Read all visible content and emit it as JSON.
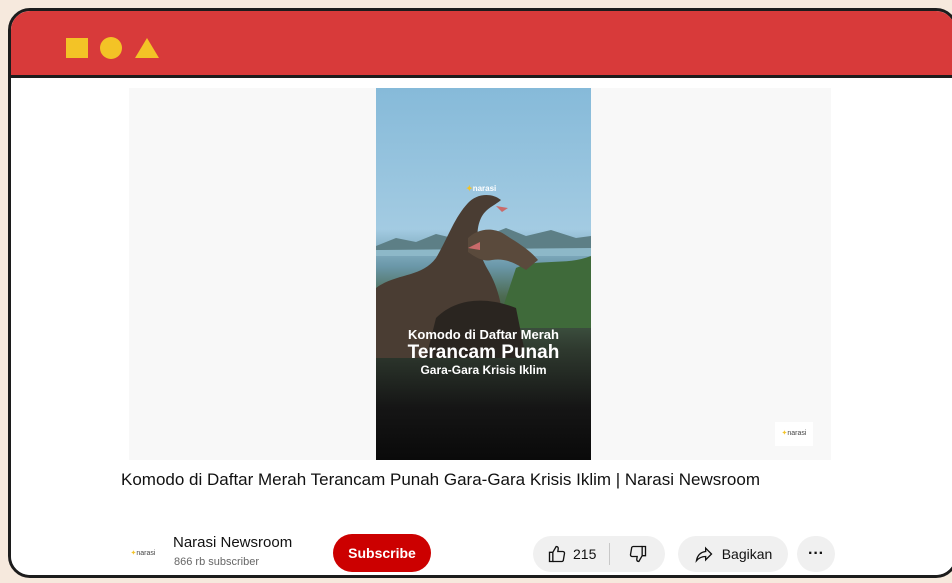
{
  "window": {
    "controls": [
      "square-icon",
      "circle-icon",
      "triangle-icon"
    ],
    "accent_color": "#d83a3a",
    "control_color": "#f3c326"
  },
  "video": {
    "overlay_line1": "Komodo di Daftar Merah",
    "overlay_line2": "Terancam Punah",
    "overlay_line3": "Gara-Gara Krisis Iklim",
    "watermark": "narasi"
  },
  "title": "Komodo di Daftar Merah Terancam Punah Gara-Gara Krisis Iklim | Narasi Newsroom",
  "channel": {
    "name": "Narasi Newsroom",
    "subscribers": "866 rb subscriber",
    "avatar_text": "narasi"
  },
  "actions": {
    "subscribe_label": "Subscribe",
    "subscribe_color": "#cc0000",
    "like_count": "215",
    "share_label": "Bagikan",
    "more_label": "···"
  }
}
